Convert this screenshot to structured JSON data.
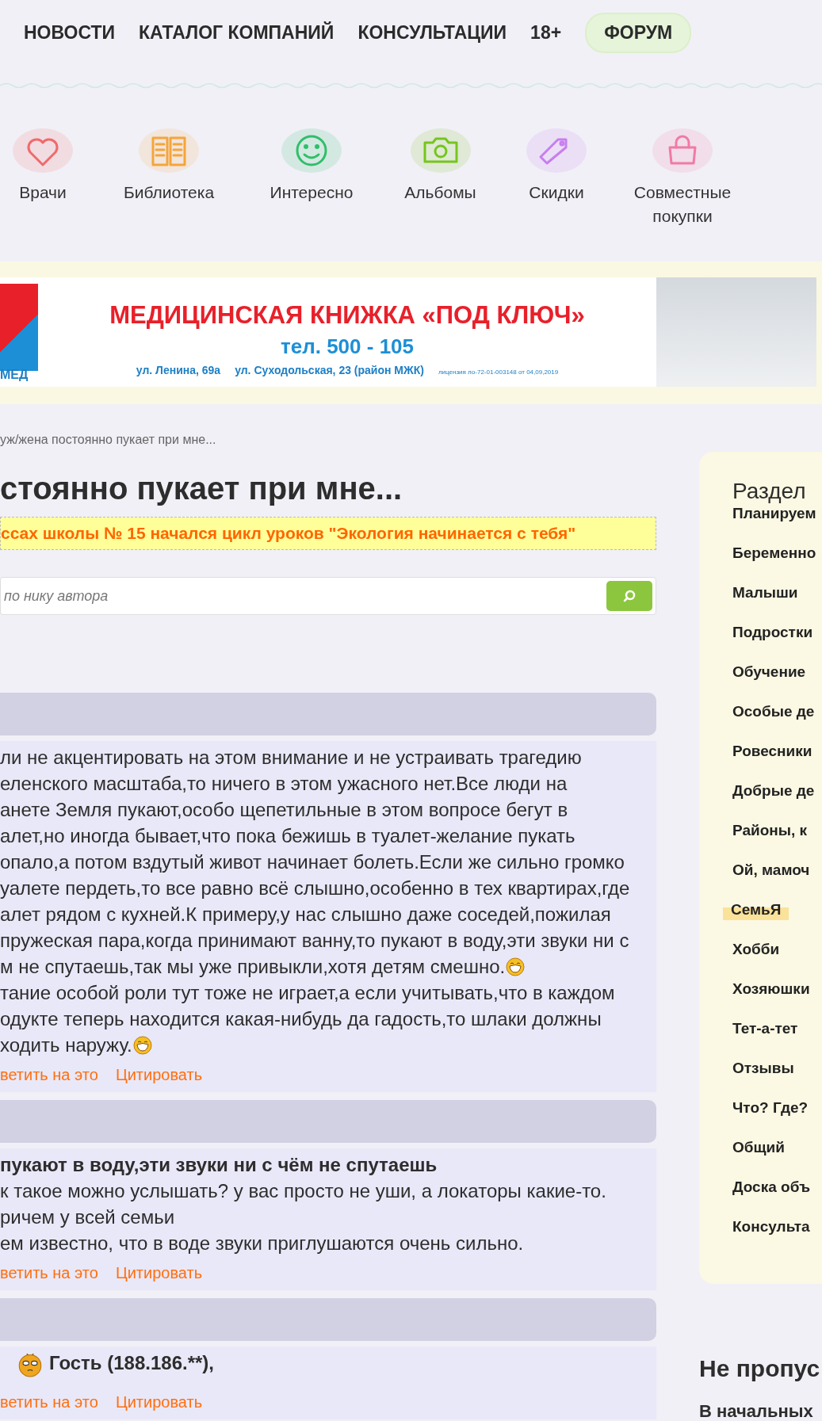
{
  "nav": [
    {
      "label": "НОВОСТИ",
      "selected": false
    },
    {
      "label": "КАТАЛОГ КОМПАНИЙ",
      "selected": false
    },
    {
      "label": "КОНСУЛЬТАЦИИ",
      "selected": false
    },
    {
      "label": "18+",
      "selected": false
    },
    {
      "label": "ФОРУМ",
      "selected": true
    }
  ],
  "categories": [
    {
      "kind": "heart",
      "label": "Врачи"
    },
    {
      "kind": "book",
      "label": "Библиотека"
    },
    {
      "kind": "smiley",
      "label": "Интересно"
    },
    {
      "kind": "camera",
      "label": "Альбомы"
    },
    {
      "kind": "tag",
      "label": "Скидки"
    },
    {
      "kind": "bag",
      "label": "Совместные покупки"
    }
  ],
  "banner": {
    "logo": "МЕД",
    "headline": "МЕДИЦИНСКАЯ КНИЖКА «ПОД КЛЮЧ»",
    "phone": "тел. 500 - 105",
    "address_1": "ул. Ленина, 69а",
    "address_2": "ул. Суходольская, 23 (район МЖК)",
    "license": "лицензия ло-72-01-003148 от 04,09,2019"
  },
  "breadcrumb": "уж/жена постоянно пукает при мне...",
  "title": "стоянно пукает при мне...",
  "notice": "ссах школы № 15 начался цикл уроков \"Экология начинается с тебя\"",
  "search": {
    "placeholder": "по нику автора"
  },
  "posts": [
    {
      "lines": [
        {
          "kind": "text",
          "text": "ли не акцентировать на этом внимание и не устраивать трагедию",
          "smiley": false
        },
        {
          "kind": "text",
          "text": "еленского масштаба,то ничего в этом ужасного нет.Все люди на",
          "smiley": false
        },
        {
          "kind": "text",
          "text": "анете Земля пукают,особо щепетильные в этом вопросе бегут в",
          "smiley": false
        },
        {
          "kind": "text",
          "text": "алет,но иногда бывает,что пока бежишь в туалет-желание пукать",
          "smiley": false
        },
        {
          "kind": "text",
          "text": "опало,а потом вздутый живот начинает болеть.Если же сильно громко",
          "smiley": false
        },
        {
          "kind": "text",
          "text": "уалете пердеть,то все равно всё слышно,особенно в тех квартирах,где",
          "smiley": false
        },
        {
          "kind": "text",
          "text": "алет рядом с кухней.К примеру,у нас слышно даже соседей,пожилая",
          "smiley": false
        },
        {
          "kind": "text",
          "text": "пружеская пара,когда принимают ванну,то пукают в воду,эти звуки ни с",
          "smiley": false
        },
        {
          "kind": "text",
          "text": "м не спутаешь,так мы уже привыкли,хотя детям смешно.",
          "smiley": true
        },
        {
          "kind": "text",
          "text": "тание особой роли тут тоже не играет,а если учитывать,что в каждом",
          "smiley": false
        },
        {
          "kind": "text",
          "text": "одукте теперь находится какая-нибудь да гадость,то шлаки должны",
          "smiley": false
        },
        {
          "kind": "text",
          "text": "ходить наружу.",
          "smiley": true
        }
      ],
      "reply": "ветить на это",
      "quote": "Цитировать"
    },
    {
      "lines": [
        {
          "kind": "quote",
          "text": "пукают в воду,эти звуки ни с чём не спутаешь"
        },
        {
          "kind": "text",
          "text": "к такое можно услышать? у вас просто не уши, а локаторы какие-то.",
          "smiley": false
        },
        {
          "kind": "text",
          "text": "ричем у всей семьи",
          "smiley": false
        },
        {
          "kind": "text",
          "text": "ем известно, что в воде звуки приглушаются очень сильно.",
          "smiley": false
        }
      ],
      "reply": "ветить на это",
      "quote": "Цитировать"
    },
    {
      "lines": [
        {
          "kind": "author",
          "text": "Гость (188.186.**),"
        }
      ],
      "reply": "ветить на это",
      "quote": "Цитировать"
    }
  ],
  "sections": {
    "title": "Раздел",
    "items": [
      {
        "label": "Планируем",
        "selected": false
      },
      {
        "label": "Беременно",
        "selected": false
      },
      {
        "label": "Малыши",
        "selected": false
      },
      {
        "label": "Подростки",
        "selected": false
      },
      {
        "label": "Обучение",
        "selected": false
      },
      {
        "label": "Особые де",
        "selected": false
      },
      {
        "label": "Ровесники",
        "selected": false
      },
      {
        "label": "Добрые де",
        "selected": false
      },
      {
        "label": "Районы, к",
        "selected": false
      },
      {
        "label": "Ой, мамоч",
        "selected": false
      },
      {
        "label": "СемьЯ",
        "selected": true
      },
      {
        "label": "Хобби",
        "selected": false
      },
      {
        "label": "Хозяюшки",
        "selected": false
      },
      {
        "label": "Тет-а-тет",
        "selected": false
      },
      {
        "label": "Отзывы",
        "selected": false
      },
      {
        "label": "Что? Где?",
        "selected": false
      },
      {
        "label": "Общий",
        "selected": false
      },
      {
        "label": "Доска объ",
        "selected": false
      },
      {
        "label": "Консульта",
        "selected": false
      }
    ]
  },
  "promo": {
    "title": "Не пропус",
    "text": "В начальных"
  }
}
